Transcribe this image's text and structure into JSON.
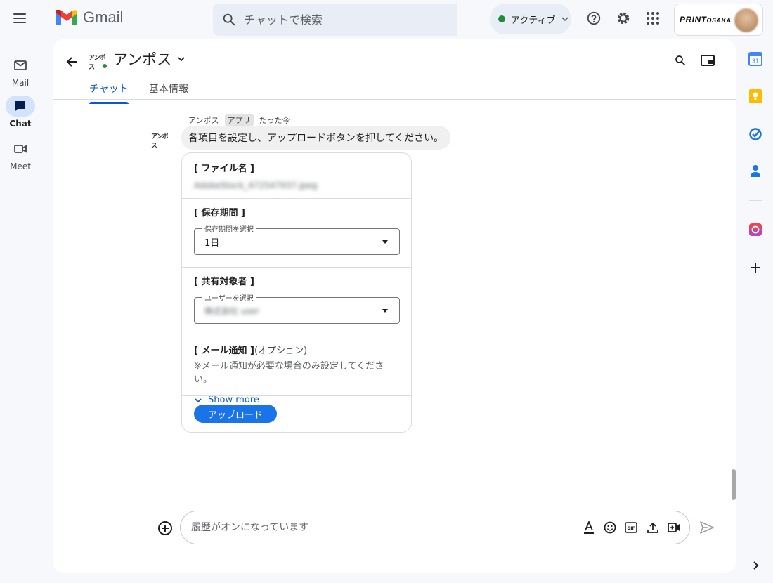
{
  "app": {
    "name": "Gmail"
  },
  "search": {
    "placeholder": "チャットで検索"
  },
  "status": {
    "label": "アクティブ"
  },
  "account": {
    "brand_main": "PRINT",
    "brand_sub": "OSAKA"
  },
  "rail": [
    {
      "label": "Mail"
    },
    {
      "label": "Chat"
    },
    {
      "label": "Meet"
    }
  ],
  "space": {
    "name": "アンポス",
    "avatar_text": "アンポス"
  },
  "tabs": [
    {
      "label": "チャット"
    },
    {
      "label": "基本情報"
    }
  ],
  "message": {
    "sender": "アンポス",
    "badge": "アプリ",
    "time": "たった今",
    "text": "各項目を設定し、アップロードボタンを押してください。"
  },
  "card": {
    "file": {
      "title": "[ ファイル名 ]",
      "value": "AdobeStock_472547937.jpeg"
    },
    "retention": {
      "title": "[ 保存期間 ]",
      "legend": "保存期間を選択",
      "selected": "1日"
    },
    "share": {
      "title": "[ 共有対象者 ]",
      "legend": "ユーザーを選択",
      "selected": "株式会社 user"
    },
    "notify": {
      "title": "[ メール通知 ]",
      "optional": "(オプション)",
      "note": "※メール通知が必要な場合のみ設定してください。",
      "show_more": "Show more"
    },
    "upload_label": "アップロード"
  },
  "composer": {
    "placeholder": "履歴がオンになっています"
  },
  "colors": {
    "accent": "#0b57d0",
    "button": "#1a73e8",
    "online": "#1e8e3e",
    "rail_active": "#d3e3fd"
  }
}
